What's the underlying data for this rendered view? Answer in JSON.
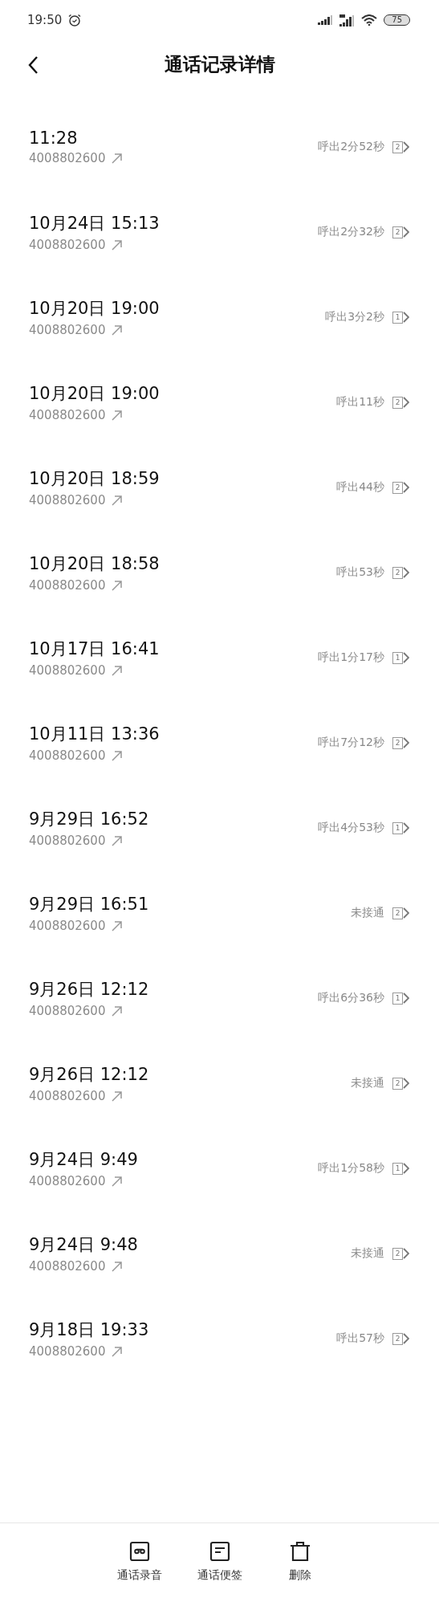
{
  "status_bar": {
    "time": "19:50",
    "battery": "75"
  },
  "header": {
    "title": "通话记录详情"
  },
  "calls": [
    {
      "time": "11:28",
      "number": "4008802600",
      "result": "呼出2分52秒",
      "sim": "2"
    },
    {
      "time": "10月24日 15:13",
      "number": "4008802600",
      "result": "呼出2分32秒",
      "sim": "2"
    },
    {
      "time": "10月20日 19:00",
      "number": "4008802600",
      "result": "呼出3分2秒",
      "sim": "1"
    },
    {
      "time": "10月20日 19:00",
      "number": "4008802600",
      "result": "呼出11秒",
      "sim": "2"
    },
    {
      "time": "10月20日 18:59",
      "number": "4008802600",
      "result": "呼出44秒",
      "sim": "2"
    },
    {
      "time": "10月20日 18:58",
      "number": "4008802600",
      "result": "呼出53秒",
      "sim": "2"
    },
    {
      "time": "10月17日 16:41",
      "number": "4008802600",
      "result": "呼出1分17秒",
      "sim": "1"
    },
    {
      "time": "10月11日 13:36",
      "number": "4008802600",
      "result": "呼出7分12秒",
      "sim": "2"
    },
    {
      "time": "9月29日 16:52",
      "number": "4008802600",
      "result": "呼出4分53秒",
      "sim": "1"
    },
    {
      "time": "9月29日 16:51",
      "number": "4008802600",
      "result": "未接通",
      "sim": "2"
    },
    {
      "time": "9月26日 12:12",
      "number": "4008802600",
      "result": "呼出6分36秒",
      "sim": "1"
    },
    {
      "time": "9月26日 12:12",
      "number": "4008802600",
      "result": "未接通",
      "sim": "2"
    },
    {
      "time": "9月24日 9:49",
      "number": "4008802600",
      "result": "呼出1分58秒",
      "sim": "1"
    },
    {
      "time": "9月24日 9:48",
      "number": "4008802600",
      "result": "未接通",
      "sim": "2"
    },
    {
      "time": "9月18日 19:33",
      "number": "4008802600",
      "result": "呼出57秒",
      "sim": "2"
    }
  ],
  "footer": [
    {
      "kind": "recording",
      "label": "通话录音"
    },
    {
      "kind": "note",
      "label": "通话便签"
    },
    {
      "kind": "delete",
      "label": "删除"
    }
  ]
}
